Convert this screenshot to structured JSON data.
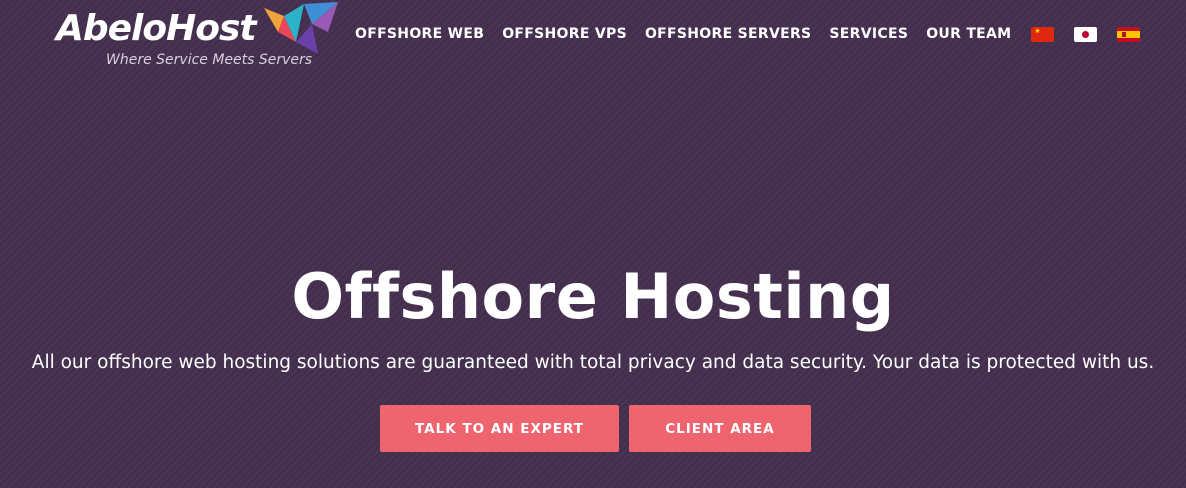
{
  "brand": {
    "name": "AbeloHost",
    "tagline": "Where Service Meets Servers"
  },
  "nav": {
    "items": [
      {
        "label": "OFFSHORE WEB"
      },
      {
        "label": "OFFSHORE VPS"
      },
      {
        "label": "OFFSHORE SERVERS"
      },
      {
        "label": "SERVICES"
      },
      {
        "label": "OUR TEAM"
      }
    ],
    "flags": [
      "china-flag-icon",
      "japan-flag-icon",
      "spain-flag-icon"
    ]
  },
  "hero": {
    "title": "Offshore Hosting",
    "subtitle": "All our offshore web hosting solutions are guaranteed with total privacy and data security. Your data is protected with us.",
    "buttons": {
      "expert": "TALK TO AN EXPERT",
      "client": "CLIENT AREA"
    }
  },
  "colors": {
    "background": "#45304f",
    "button": "#ee6570",
    "text": "#ffffff"
  }
}
